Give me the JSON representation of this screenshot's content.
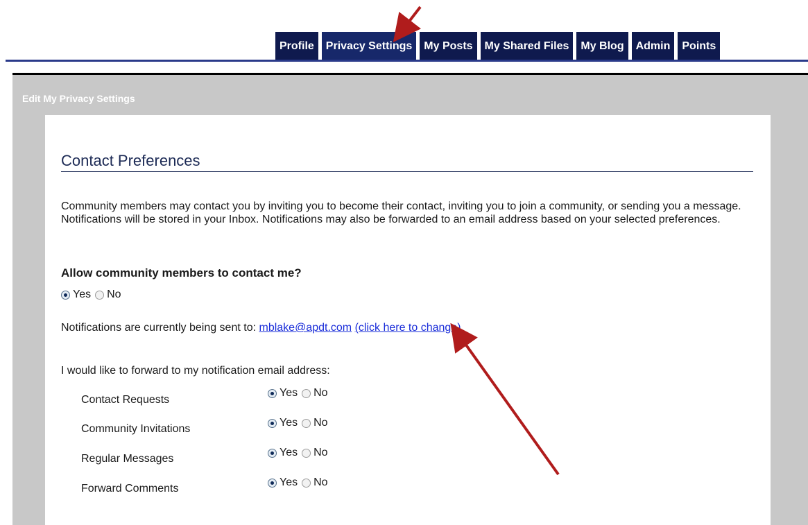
{
  "tabs": [
    "Profile",
    "Privacy Settings",
    "My Posts",
    "My Shared Files",
    "My Blog",
    "Admin",
    "Points"
  ],
  "active_tab": "Privacy Settings",
  "panel": {
    "title": "Edit My Privacy Settings"
  },
  "section": {
    "title": "Contact Preferences",
    "intro": "Community members may contact you by inviting you to become their contact, inviting you to join a community, or sending you a message. Notifications will be stored in your Inbox. Notifications may also be forwarded to an email address based on your selected preferences.",
    "question": "Allow community members to contact me?",
    "allow_contact": {
      "yes_label": "Yes",
      "no_label": "No",
      "selected": "Yes"
    },
    "notify_text": "Notifications are currently being sent to:",
    "email": "mblake@apdt.com",
    "change_link": "(click here to change)",
    "forward_intro": "I would like to forward to my notification email address:",
    "forward_options": [
      {
        "label": "Contact Requests",
        "yes": "Yes",
        "no": "No",
        "selected": "Yes"
      },
      {
        "label": "Community Invitations",
        "yes": "Yes",
        "no": "No",
        "selected": "Yes"
      },
      {
        "label": "Regular Messages",
        "yes": "Yes",
        "no": "No",
        "selected": "Yes"
      },
      {
        "label": "Forward Comments",
        "yes": "Yes",
        "no": "No",
        "selected": "Yes"
      }
    ]
  },
  "colors": {
    "tab_bg": "#0f1a4e",
    "link": "#1a2dd9",
    "arrow": "#b01c1c",
    "panel_bg": "#c8c8c8"
  }
}
